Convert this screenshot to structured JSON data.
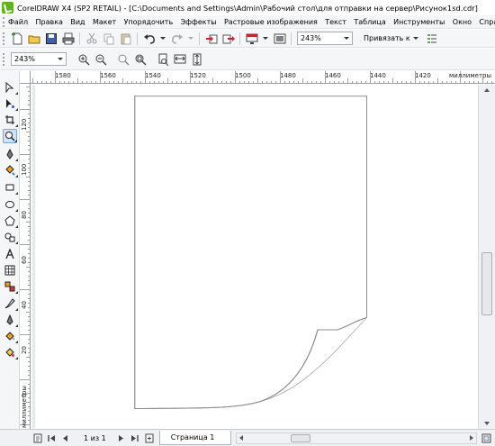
{
  "titlebar": {
    "title": "CorelDRAW X4 (SP2 RETAIL) - [C:\\Documents and Settings\\Admin\\Рабочий стол\\для отправки на сервер\\Рисунок1sd.cdr]"
  },
  "menubar": {
    "items": [
      {
        "label": "Файл"
      },
      {
        "label": "Правка"
      },
      {
        "label": "Вид"
      },
      {
        "label": "Макет"
      },
      {
        "label": "Упорядочить"
      },
      {
        "label": "Эффекты"
      },
      {
        "label": "Растровые изображения"
      },
      {
        "label": "Текст"
      },
      {
        "label": "Таблица"
      },
      {
        "label": "Инструменты"
      },
      {
        "label": "Окно"
      },
      {
        "label": "Справк"
      }
    ]
  },
  "toolbar": {
    "zoom_value": "243%",
    "snap_label": "Привязать к"
  },
  "property_bar": {
    "zoom_value": "243%"
  },
  "ruler_top": {
    "labels": [
      "1580",
      "1560",
      "1540",
      "1520",
      "1500",
      "1480",
      "1460",
      "1440",
      "1420"
    ],
    "unit": "миллиметры"
  },
  "ruler_left": {
    "labels": [
      "120",
      "100",
      "80",
      "60",
      "40",
      "20",
      "0"
    ],
    "unit": "миллиметры"
  },
  "statusbar": {
    "page_count": "1 из 1",
    "page_tab": "Страница 1"
  },
  "colors": {
    "app_logo": "#5fb31f",
    "active_tool_bg": "#cfe2f6",
    "toolbar_bg": "#f5f6f8"
  }
}
